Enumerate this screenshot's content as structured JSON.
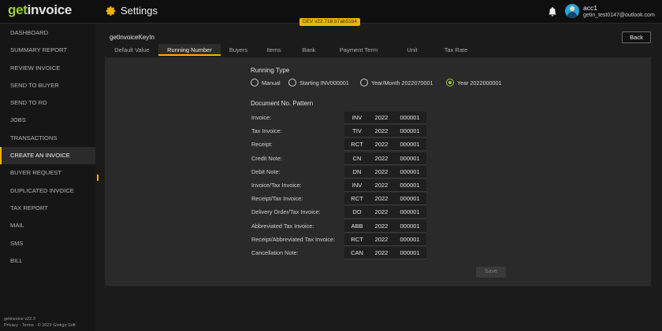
{
  "app": {
    "logo_g": "get",
    "logo_rest": "invoice",
    "page_heading": "Settings",
    "dev_badge": "DEV v22.718.b7ab51b4",
    "user_name": "acc1",
    "user_email": "getin_test0147@outlook.com"
  },
  "sidebar": {
    "items": [
      {
        "label": "DASHBOARD",
        "active": false
      },
      {
        "label": "SUMMARY REPORT",
        "active": false
      },
      {
        "label": "REVIEW INVOICE",
        "active": false
      },
      {
        "label": "SEND TO BUYER",
        "active": false
      },
      {
        "label": "SEND TO RD",
        "active": false
      },
      {
        "label": "JOBS",
        "active": false
      },
      {
        "label": "TRANSACTIONS",
        "active": false
      },
      {
        "label": "CREATE AN INVOICE",
        "active": true
      },
      {
        "label": "BUYER REQUEST",
        "active": false
      },
      {
        "label": "DUPLICATED INVOICE",
        "active": false
      },
      {
        "label": "TAX REPORT",
        "active": false
      },
      {
        "label": "MAIL",
        "active": false
      },
      {
        "label": "SMS",
        "active": false
      },
      {
        "label": "BILL",
        "active": false
      }
    ],
    "footer_version": "getinvoice v22.3",
    "footer_privacy": "Privacy",
    "footer_sep": "·",
    "footer_terms": "Terms",
    "footer_copyright": "© 2022 Ginkgo Soft"
  },
  "main": {
    "page_title": "getInvoiceKeyIn",
    "back_label": "Back",
    "tabs": [
      {
        "label": "Default Value",
        "active": false
      },
      {
        "label": "Running Number",
        "active": true
      },
      {
        "label": "Buyers",
        "active": false
      },
      {
        "label": "Items",
        "active": false
      },
      {
        "label": "Bank",
        "active": false
      },
      {
        "label": "Payment Term",
        "active": false
      },
      {
        "label": "Unit",
        "active": false
      },
      {
        "label": "Tax Rate",
        "active": false
      }
    ],
    "running_type_label": "Running Type",
    "running_type_options": [
      {
        "label": "Manual",
        "checked": false
      },
      {
        "label": "Starting INV000001",
        "checked": false
      },
      {
        "label": "Year/Month 2022070001",
        "checked": false
      },
      {
        "label": "Year 2022000001",
        "checked": true
      }
    ],
    "pattern_label": "Document No. Pattern",
    "patterns": [
      {
        "label": "Invoice:",
        "prefix": "INV",
        "year": "2022",
        "number": "000001"
      },
      {
        "label": "Tax Invoice:",
        "prefix": "TIV",
        "year": "2022",
        "number": "000001"
      },
      {
        "label": "Receipt:",
        "prefix": "RCT",
        "year": "2022",
        "number": "000001"
      },
      {
        "label": "Credit Note:",
        "prefix": "CN",
        "year": "2022",
        "number": "000001"
      },
      {
        "label": "Debit Note:",
        "prefix": "DN",
        "year": "2022",
        "number": "000001"
      },
      {
        "label": "Invoice/Tax Invoice:",
        "prefix": "INV",
        "year": "2022",
        "number": "000001"
      },
      {
        "label": "Receipt/Tax Invoice:",
        "prefix": "RCT",
        "year": "2022",
        "number": "000001"
      },
      {
        "label": "Delivery Order/Tax Invoice:",
        "prefix": "DO",
        "year": "2022",
        "number": "000001"
      },
      {
        "label": "Abbreviated Tax Invoice:",
        "prefix": "ABB",
        "year": "2022",
        "number": "000001"
      },
      {
        "label": "Receipt/Abbreviated Tax Invoice:",
        "prefix": "RCT",
        "year": "2022",
        "number": "000001"
      },
      {
        "label": "Cancellation Note:",
        "prefix": "CAN",
        "year": "2022",
        "number": "000001"
      }
    ],
    "save_label": "Save"
  },
  "colors": {
    "accent": "#f0b400",
    "brand_green": "#9ccc3a",
    "background": "#1b1b1b",
    "panel": "#2a2a2a"
  },
  "icons": {
    "settings": "gear-icon",
    "notifications": "bell-icon",
    "user": "avatar"
  }
}
